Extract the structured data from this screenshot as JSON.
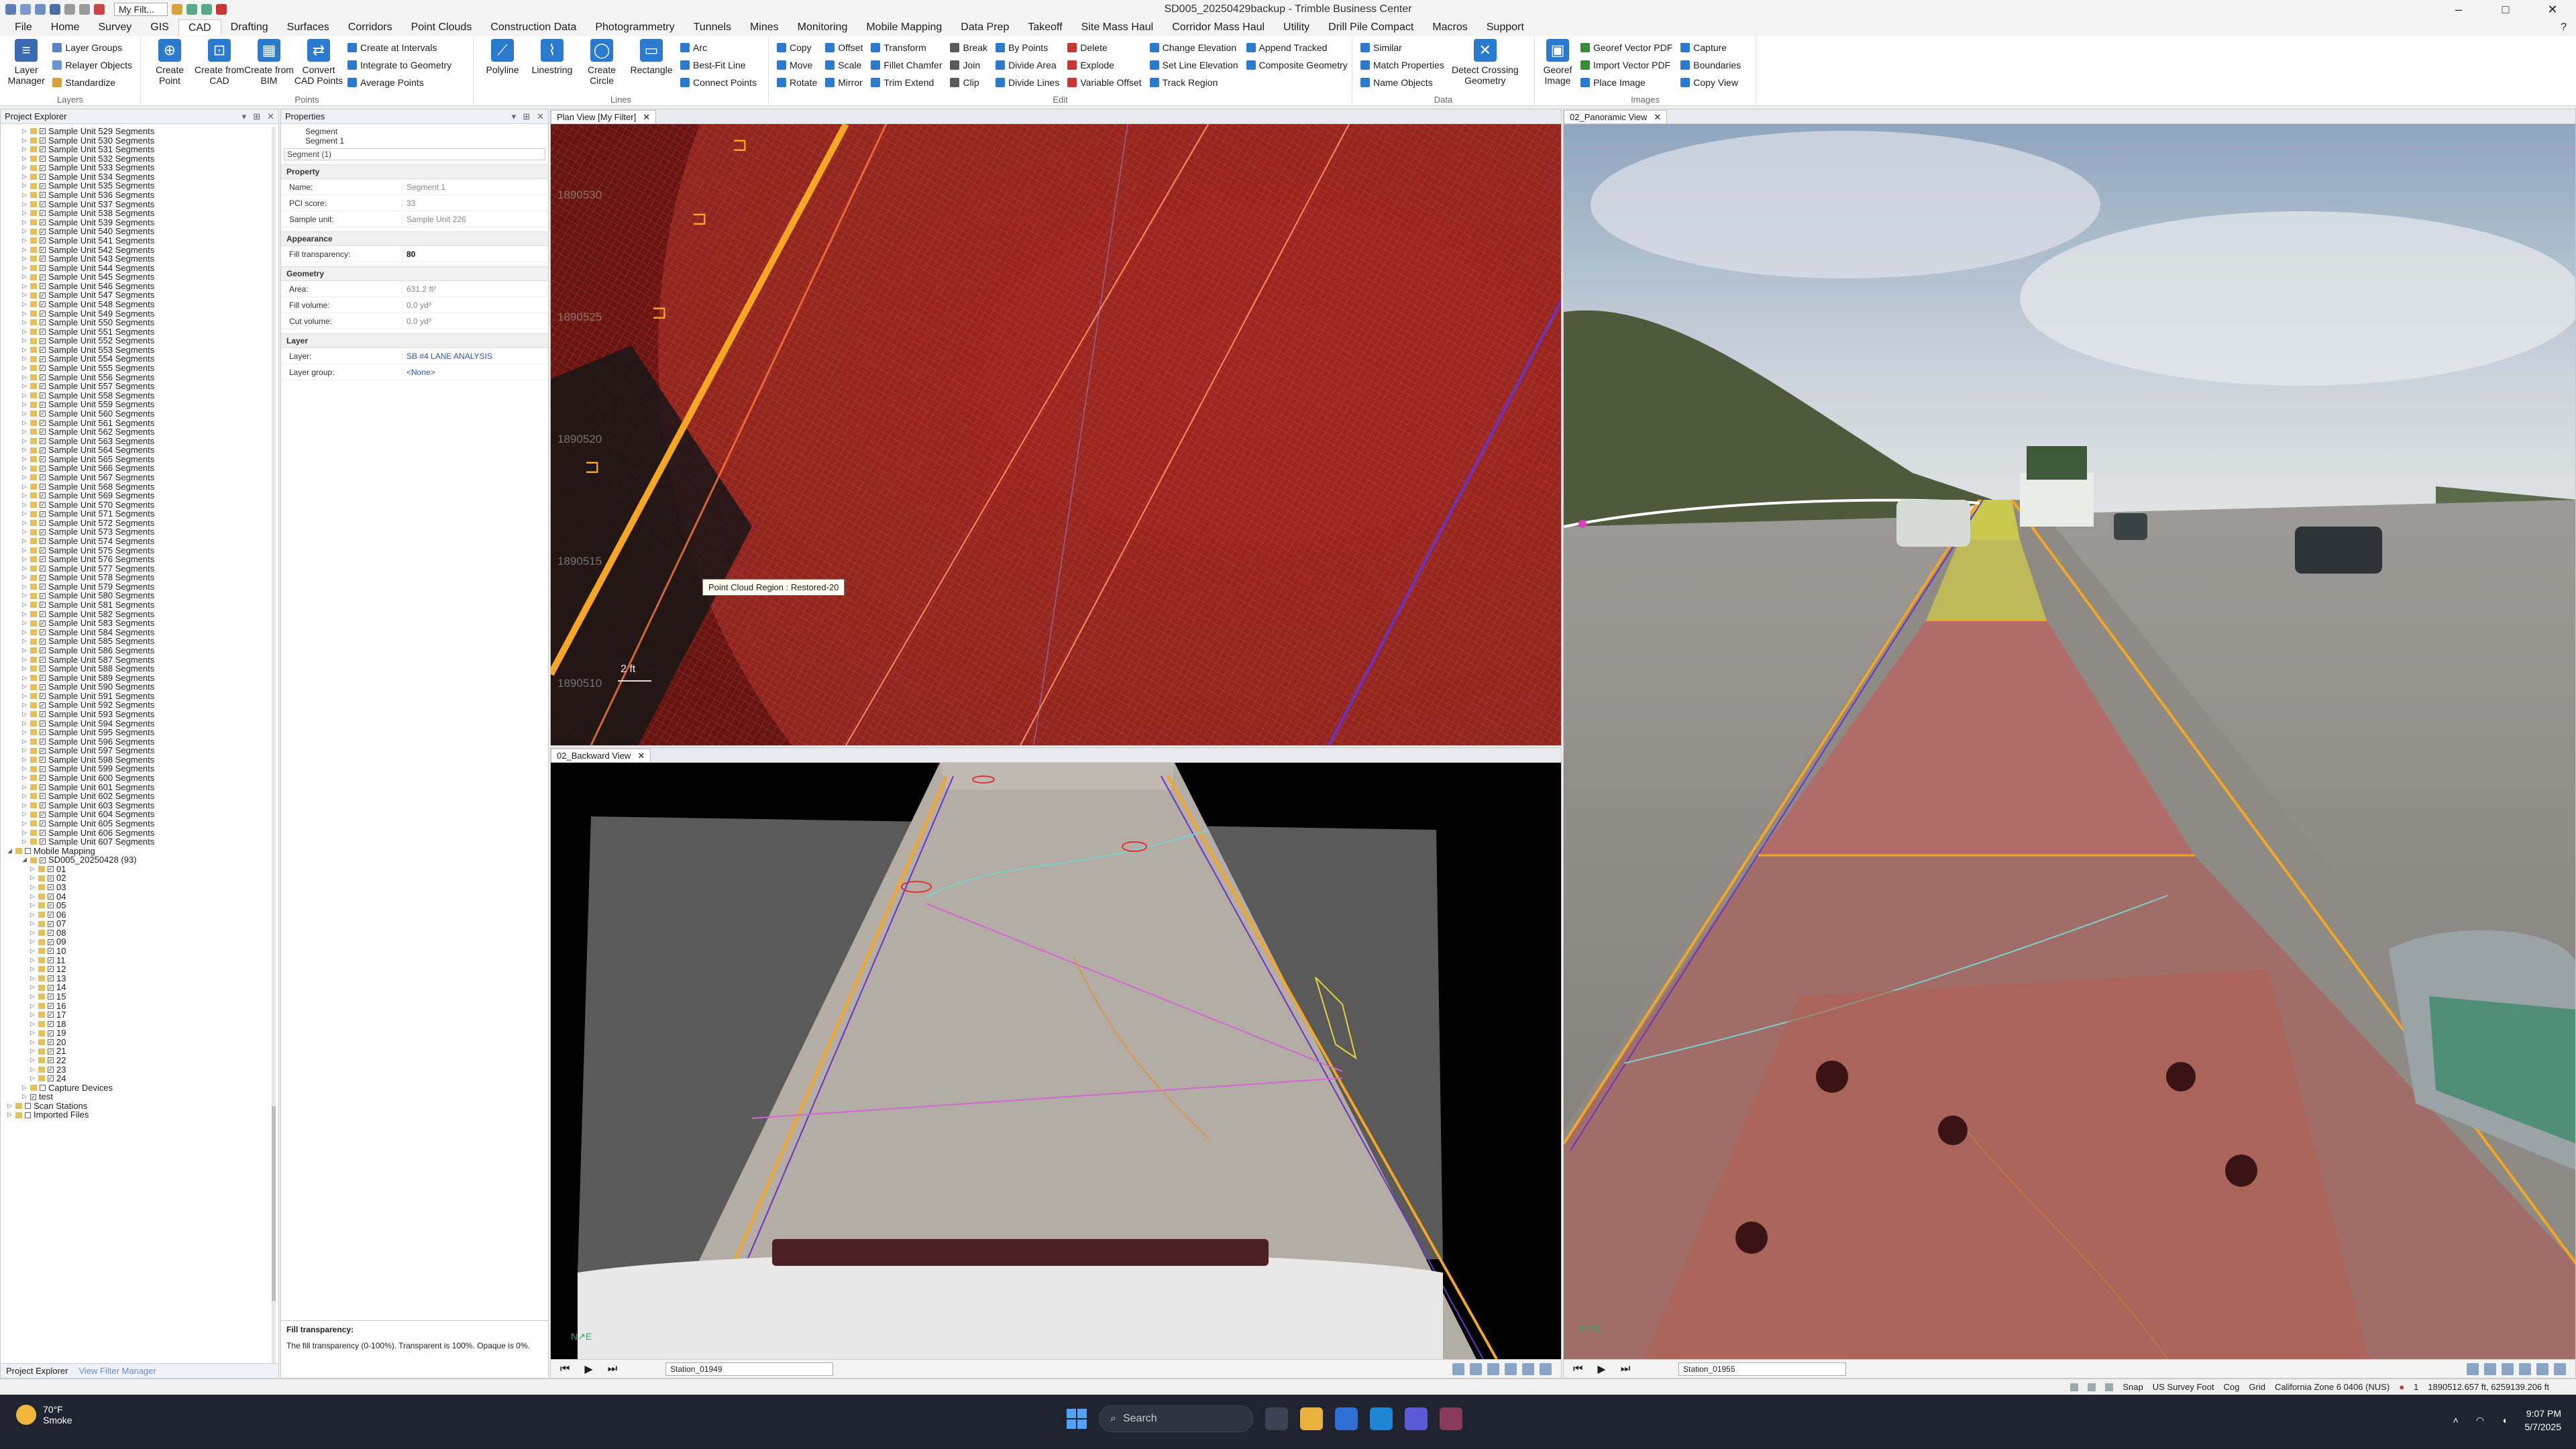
{
  "window": {
    "title": "SD005_20250429backup - Trimble Business Center",
    "filter": "My Filt..."
  },
  "menu_tabs": [
    "File",
    "Home",
    "Survey",
    "GIS",
    "CAD",
    "Drafting",
    "Surfaces",
    "Corridors",
    "Point Clouds",
    "Construction Data",
    "Photogrammetry",
    "Tunnels",
    "Mines",
    "Monitoring",
    "Mobile Mapping",
    "Data Prep",
    "Takeoff",
    "Site Mass Haul",
    "Corridor Mass Haul",
    "Utility",
    "Drill Pile Compact",
    "Macros",
    "Support"
  ],
  "active_tab": "CAD",
  "ribbon": {
    "layers": {
      "label": "Layers",
      "layer_manager": "Layer Manager",
      "layer_groups": "Layer Groups",
      "relayer_objects": "Relayer Objects",
      "standardize": "Standardize"
    },
    "points": {
      "label": "Points",
      "create_point": "Create Point",
      "create_from_cad": "Create from CAD",
      "create_from_bim": "Create from BIM",
      "convert_cad_points": "Convert CAD Points",
      "create_at_intervals": "Create at Intervals",
      "integrate_to_geometry": "Integrate to Geometry",
      "average_points": "Average Points"
    },
    "lines": {
      "label": "Lines",
      "polyline": "Polyline",
      "linestring": "Linestring",
      "create_circle": "Create Circle",
      "rectangle": "Rectangle",
      "arc": "Arc",
      "best_fit_line": "Best-Fit Line",
      "connect_points": "Connect Points"
    },
    "edit": {
      "label": "Edit",
      "items": [
        [
          "Copy",
          "Offset",
          "Transform",
          "Break",
          "By Points",
          "Delete",
          "Change Elevation",
          "Append Tracked"
        ],
        [
          "Move",
          "Scale",
          "Fillet Chamfer",
          "Join",
          "Divide Area",
          "Explode",
          "Set Line Elevation",
          "Composite Geometry"
        ],
        [
          "Rotate",
          "Mirror",
          "Trim Extend",
          "Clip",
          "Divide Lines",
          "Variable Offset",
          "Track Region",
          ""
        ]
      ]
    },
    "data": {
      "label": "Data",
      "similar": "Similar",
      "match_properties": "Match Properties",
      "name_objects": "Name Objects",
      "detect_crossing": "Detect Crossing Geometry"
    },
    "images": {
      "label": "Images",
      "georef_image": "Georef Image",
      "georef_vector_pdf": "Georef Vector PDF",
      "import_vector_pdf": "Import Vector PDF",
      "place_image": "Place Image",
      "capture": "Capture",
      "boundaries": "Boundaries",
      "copy_view": "Copy View"
    }
  },
  "explorer": {
    "title": "Project Explorer",
    "units": [
      "Sample Unit 529 Segments",
      "Sample Unit 530 Segments",
      "Sample Unit 531 Segments",
      "Sample Unit 532 Segments",
      "Sample Unit 533 Segments",
      "Sample Unit 534 Segments",
      "Sample Unit 535 Segments",
      "Sample Unit 536 Segments",
      "Sample Unit 537 Segments",
      "Sample Unit 538 Segments",
      "Sample Unit 539 Segments",
      "Sample Unit 540 Segments",
      "Sample Unit 541 Segments",
      "Sample Unit 542 Segments",
      "Sample Unit 543 Segments",
      "Sample Unit 544 Segments",
      "Sample Unit 545 Segments",
      "Sample Unit 546 Segments",
      "Sample Unit 547 Segments",
      "Sample Unit 548 Segments",
      "Sample Unit 549 Segments",
      "Sample Unit 550 Segments",
      "Sample Unit 551 Segments",
      "Sample Unit 552 Segments",
      "Sample Unit 553 Segments",
      "Sample Unit 554 Segments",
      "Sample Unit 555 Segments",
      "Sample Unit 556 Segments",
      "Sample Unit 557 Segments",
      "Sample Unit 558 Segments",
      "Sample Unit 559 Segments",
      "Sample Unit 560 Segments",
      "Sample Unit 561 Segments",
      "Sample Unit 562 Segments",
      "Sample Unit 563 Segments",
      "Sample Unit 564 Segments",
      "Sample Unit 565 Segments",
      "Sample Unit 566 Segments",
      "Sample Unit 567 Segments",
      "Sample Unit 568 Segments",
      "Sample Unit 569 Segments",
      "Sample Unit 570 Segments",
      "Sample Unit 571 Segments",
      "Sample Unit 572 Segments",
      "Sample Unit 573 Segments",
      "Sample Unit 574 Segments",
      "Sample Unit 575 Segments",
      "Sample Unit 576 Segments",
      "Sample Unit 577 Segments",
      "Sample Unit 578 Segments",
      "Sample Unit 579 Segments",
      "Sample Unit 580 Segments",
      "Sample Unit 581 Segments",
      "Sample Unit 582 Segments",
      "Sample Unit 583 Segments",
      "Sample Unit 584 Segments",
      "Sample Unit 585 Segments",
      "Sample Unit 586 Segments",
      "Sample Unit 587 Segments",
      "Sample Unit 588 Segments",
      "Sample Unit 589 Segments",
      "Sample Unit 590 Segments",
      "Sample Unit 591 Segments",
      "Sample Unit 592 Segments",
      "Sample Unit 593 Segments",
      "Sample Unit 594 Segments",
      "Sample Unit 595 Segments",
      "Sample Unit 596 Segments",
      "Sample Unit 597 Segments",
      "Sample Unit 598 Segments",
      "Sample Unit 599 Segments",
      "Sample Unit 600 Segments",
      "Sample Unit 601 Segments",
      "Sample Unit 602 Segments",
      "Sample Unit 603 Segments",
      "Sample Unit 604 Segments",
      "Sample Unit 605 Segments",
      "Sample Unit 606 Segments",
      "Sample Unit 607 Segments"
    ],
    "mobile_mapping": "Mobile Mapping",
    "run": "SD005_20250428 (93)",
    "runs": [
      "01",
      "02",
      "03",
      "04",
      "05",
      "06",
      "07",
      "08",
      "09",
      "10",
      "11",
      "12",
      "13",
      "14",
      "15",
      "16",
      "17",
      "18",
      "19",
      "20",
      "21",
      "22",
      "23",
      "24"
    ],
    "capture_devices": "Capture Devices",
    "test": "test",
    "scan_stations": "Scan Stations",
    "imported_files": "Imported Files",
    "footer_tab1": "Project Explorer",
    "footer_tab2": "View Filter Manager"
  },
  "properties": {
    "title": "Properties",
    "seg1": "Segment",
    "seg2": "Segment 1",
    "selector": "Segment (1)",
    "sec_property": "Property",
    "sec_appearance": "Appearance",
    "sec_geometry": "Geometry",
    "sec_layer": "Layer",
    "rows": {
      "name": [
        "Name:",
        "Segment 1"
      ],
      "pci": [
        "PCI score:",
        "33"
      ],
      "unit": [
        "Sample unit:",
        "Sample Unit 226"
      ],
      "fill": [
        "Fill transparency:",
        "80"
      ],
      "area": [
        "Area:",
        "631.2 ft²"
      ],
      "fillvol": [
        "Fill volume:",
        "0.0 yd³"
      ],
      "cutvol": [
        "Cut volume:",
        "0.0 yd³"
      ],
      "layer": [
        "Layer:",
        "SB #4 LANE ANALYSIS"
      ],
      "group": [
        "Layer group:",
        "<None>"
      ]
    },
    "desc_title": "Fill transparency:",
    "desc_text": "The fill transparency (0-100%). Transparent is 100%. Opaque is 0%."
  },
  "plan_view": {
    "tab": "Plan View [My Filter]",
    "tooltip": "Point Cloud Region : Restored-20",
    "scale": "2 ft",
    "labels": [
      "1890530",
      "1890525",
      "1890520",
      "1890515",
      "1890510"
    ]
  },
  "backward_view": {
    "tab": "02_Backward View",
    "station": "Station_01949"
  },
  "panoramic_view": {
    "tab": "02_Panoramic View",
    "station": "Station_01955"
  },
  "status_bar": {
    "snap": "Snap",
    "units": "US Survey Foot",
    "cog": "Cog",
    "grid": "Grid",
    "zone": "California Zone 6 0406 (NUS)",
    "page": "1",
    "coords": "1890512.657 ft, 6259139.206 ft"
  },
  "taskbar": {
    "temp": "70°F",
    "weather": "Smoke",
    "search": "Search",
    "time": "9:07 PM",
    "date": "5/7/2025"
  },
  "colors": {
    "accent": "#2a57b6",
    "road_red": "#d9484a",
    "lane_orange": "#f5a623",
    "lane_purple": "#6a33c8",
    "yellow": "#e6e23a"
  }
}
